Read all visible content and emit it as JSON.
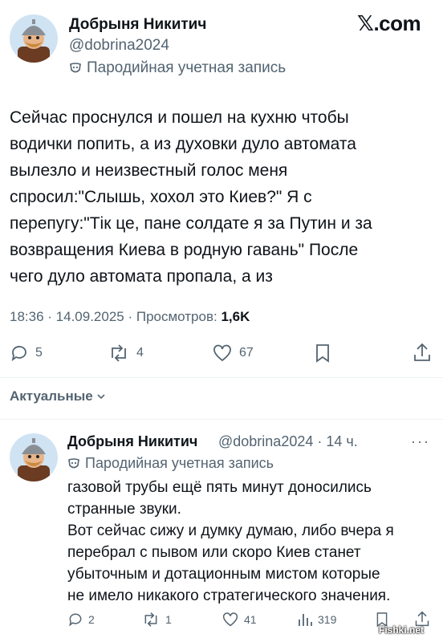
{
  "brand": {
    "logo_x": "𝕏",
    "logo_text": ".com"
  },
  "main_tweet": {
    "author_name": "Добрыня Никитич",
    "handle": "@dobrina2024",
    "parody_label": "Пародийная учетная запись",
    "text": "Сейчас проснулся и пошел на кухню чтобы\nводички попить, а из духовки дуло автомата\nвылезло и неизвестный голос меня\nспросил:\"Слышь, хохол это Киев?\" Я с\nперепугу:\"Тік це, пане солдате я за Путин и за\nвозвращения Киева в родную гавань\" После\nчего дуло автомата пропала, а из",
    "time": "18:36",
    "date": "14.09.2025",
    "views_label": "Просмотров:",
    "views": "1,6K",
    "replies": "5",
    "reposts": "4",
    "likes": "67"
  },
  "tabs": {
    "relevant": "Актуальные"
  },
  "reply_tweet": {
    "author_name": "Добрыня Никитич",
    "handle": "@dobrina2024",
    "age": "14 ч.",
    "parody_label": "Пародийная учетная запись",
    "text": "газовой трубы ещё пять минут доносились\nстранные звуки.\nВот сейчас сижу и думку думаю, либо вчера я\nперебрал с пывом или скоро Киев станет\nубыточным и дотационным мистом которые\nне имело никакого стратегического значения.",
    "replies": "2",
    "reposts": "1",
    "likes": "41",
    "views": "319"
  },
  "watermark": "Fishki.net",
  "colors": {
    "text": "#0f1419",
    "secondary": "#536471",
    "divider": "#eff3f4"
  },
  "icons": [
    "reply-icon",
    "repost-icon",
    "like-icon",
    "bookmark-icon",
    "share-icon",
    "views-icon",
    "parody-mask-icon",
    "more-icon",
    "chevron-down-icon"
  ]
}
